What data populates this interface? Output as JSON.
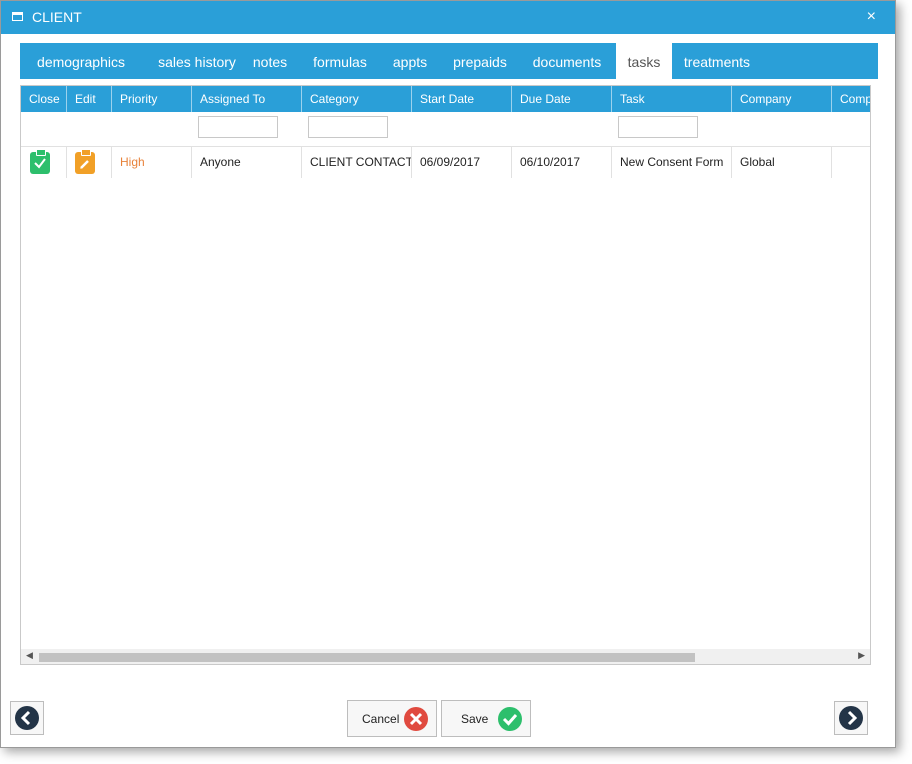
{
  "window": {
    "title": "CLIENT",
    "close_label": "×"
  },
  "tabs": [
    "demographics",
    "sales history",
    "notes",
    "formulas",
    "appts",
    "prepaids",
    "documents",
    "tasks",
    "treatments"
  ],
  "active_tab": "tasks",
  "grid": {
    "columns": [
      "Close",
      "Edit",
      "Priority",
      "Assigned To",
      "Category",
      "Start Date",
      "Due Date",
      "Task",
      "Company",
      "Comp"
    ],
    "rows": [
      {
        "priority": "High",
        "assigned_to": "Anyone",
        "category": "CLIENT CONTACT",
        "start_date": "06/09/2017",
        "due_date": "06/10/2017",
        "task": "New Consent Form",
        "company": "Global",
        "comp": ""
      }
    ]
  },
  "scrollbar": {
    "left_arrow": "◀",
    "right_arrow": "▶"
  },
  "footer": {
    "cancel_label": "Cancel",
    "save_label": "Save"
  },
  "colors": {
    "accent": "#2a9fd8",
    "priority_high": "#e8823a",
    "save": "#2dbf6c",
    "cancel": "#e04a3f",
    "nav": "#233447"
  }
}
